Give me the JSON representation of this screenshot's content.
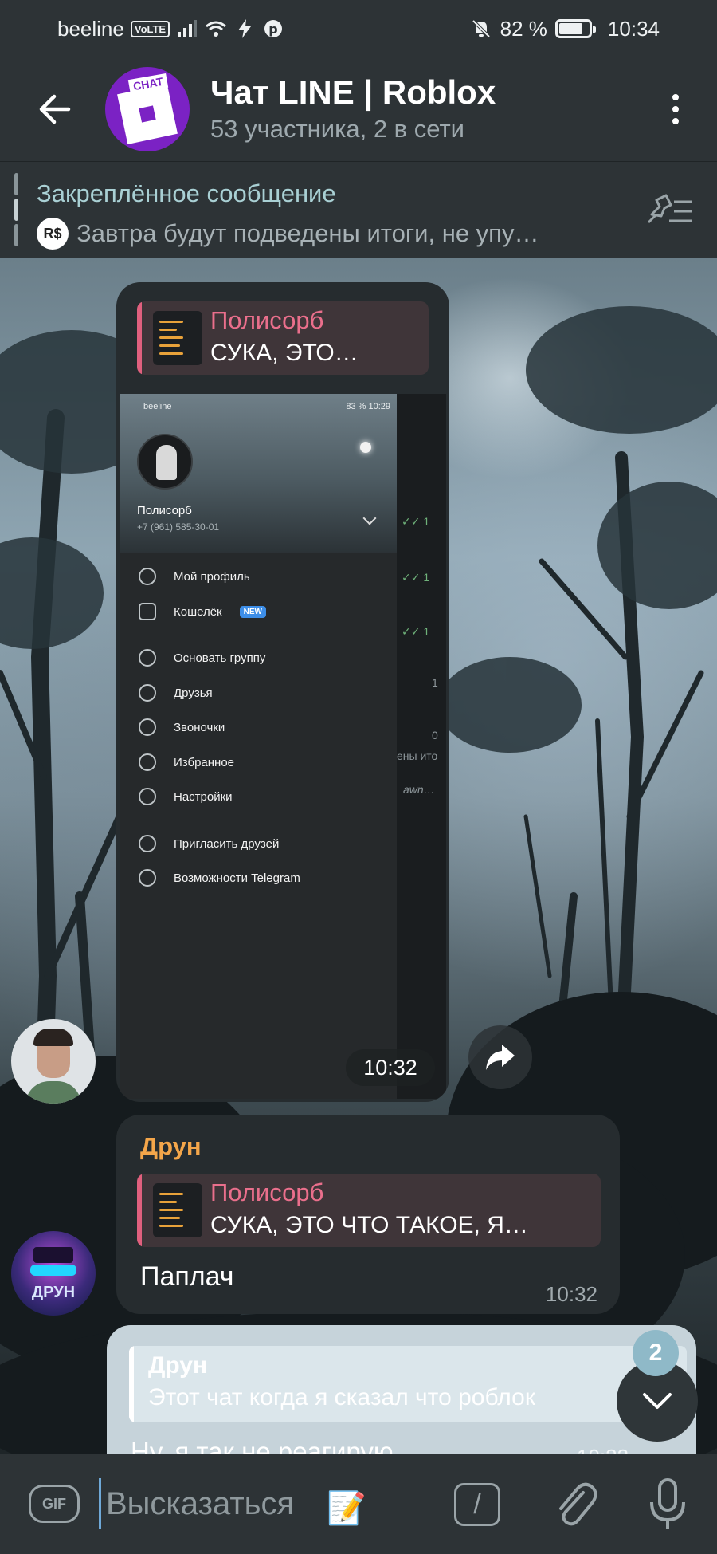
{
  "status_bar": {
    "carrier": "beeline",
    "volte": "VoLTE",
    "battery": "82 %",
    "time": "10:34"
  },
  "header": {
    "title": "Чат LINE | Roblox",
    "subtitle": "53 участника, 2 в сети",
    "avatar_tag": "CHAT"
  },
  "pinned": {
    "title": "Закреплённое сообщение",
    "icon_text": "R$",
    "text": "Завтра будут подведены итоги, не упу…"
  },
  "forwarded_image": {
    "reply_name": "Полисорб",
    "reply_text": "СУКА, ЭТО…",
    "time": "10:32",
    "screenshot": {
      "carrier": "beeline",
      "battery": "83 %",
      "time": "10:29",
      "profile_name": "Полисорб",
      "phone": "+7 (961) 585-30-01",
      "new_badge": "NEW",
      "menu": [
        "Мой профиль",
        "Кошелёк",
        "Основать группу",
        "Друзья",
        "Звоночки",
        "Избранное",
        "Настройки",
        "Пригласить друзей",
        "Возможности Telegram"
      ],
      "right_snippets": [
        "1",
        "1",
        "1",
        "1",
        "0",
        "ены ито",
        "awn…"
      ]
    }
  },
  "message_1": {
    "sender": "Друн",
    "reply_name": "Полисорб",
    "reply_text": "СУКА, ЭТО ЧТО ТАКОЕ, Я…",
    "text": "Паплач",
    "time": "10:32"
  },
  "avatar_2_label": "ДРУН",
  "message_2": {
    "quote_name": "Друн",
    "quote_text": "Этот чат когда я сказал что роблок",
    "text": "Ну, я так не реагирую",
    "time": "10:33"
  },
  "scroll": {
    "unread_count": "2"
  },
  "input": {
    "gif_label": "GIF",
    "placeholder": "Высказаться",
    "emoji": "📝",
    "command_label": "/"
  }
}
